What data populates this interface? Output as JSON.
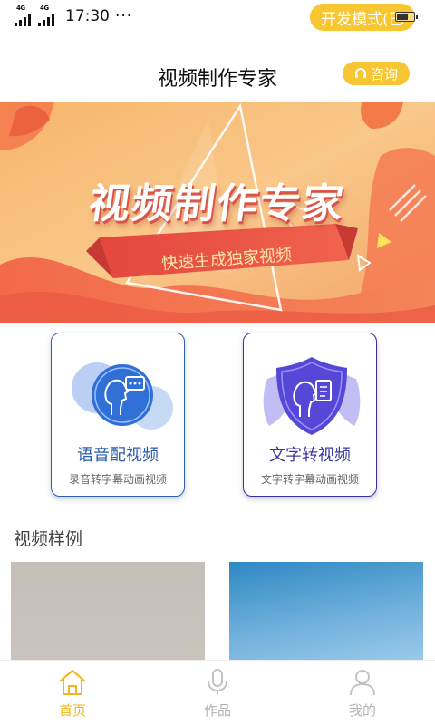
{
  "status_bar": {
    "network_1": "4G",
    "network_2": "4G",
    "time": "17:30",
    "dots": "···",
    "dev_mode_label": "开发模式(已"
  },
  "header": {
    "title": "视频制作专家",
    "consult_label": "咨询"
  },
  "banner": {
    "title": "视频制作专家",
    "ribbon_text": "快速生成独家视频"
  },
  "features": [
    {
      "title": "语音配视频",
      "subtitle": "录音转字幕动画视频",
      "icon": "speech-head-icon"
    },
    {
      "title": "文字转视频",
      "subtitle": "文字转字幕动画视频",
      "icon": "document-head-icon"
    }
  ],
  "samples": {
    "title": "视频样例"
  },
  "bottom_nav": {
    "items": [
      {
        "label": "首页",
        "icon": "home-icon",
        "active": true
      },
      {
        "label": "作品",
        "icon": "microphone-icon",
        "active": false
      },
      {
        "label": "我的",
        "icon": "profile-icon",
        "active": false
      }
    ]
  },
  "colors": {
    "accent": "#f7c630",
    "active_nav": "#f2b51c",
    "card_blue": "#2f5fb3",
    "card_indigo": "#3a2f9a"
  }
}
